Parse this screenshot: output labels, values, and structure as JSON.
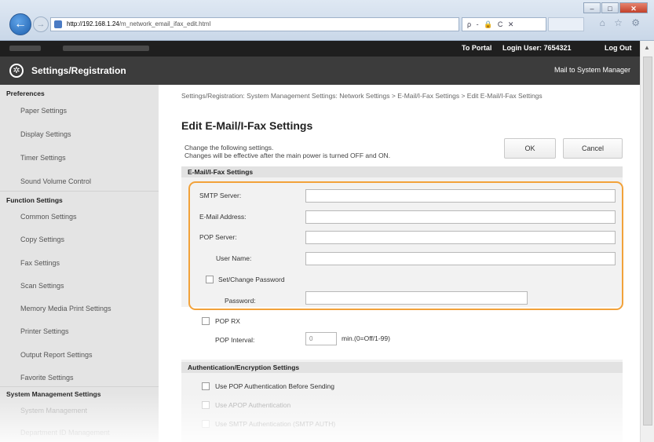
{
  "browser": {
    "url_host": "http://192.168.1.24",
    "url_path": "/m_network_email_ifax_edit.html",
    "addr_tools": "ρ - 🔒 C ✕",
    "window_buttons": {
      "minimize": "–",
      "maximize": "□",
      "close": "✕"
    },
    "right_icons": "⌂ ☆ ⚙"
  },
  "header": {
    "to_portal": "To Portal",
    "login_user": "Login User:  7654321",
    "log_out": "Log Out",
    "title": "Settings/Registration",
    "mail_link": "Mail to System Manager"
  },
  "sidebar": {
    "sections": [
      {
        "label": "Preferences",
        "items": [
          "Paper Settings",
          "Display Settings",
          "Timer Settings",
          "Sound Volume Control"
        ]
      },
      {
        "label": "Function Settings",
        "items": [
          "Common Settings",
          "Copy Settings",
          "Fax Settings",
          "Scan Settings",
          "Memory Media Print Settings",
          "Printer Settings",
          "Output Report Settings",
          "Favorite Settings"
        ]
      },
      {
        "label": "System Management Settings",
        "items": [
          "System Management",
          "Department ID Management"
        ]
      }
    ]
  },
  "main": {
    "breadcrumb": "Settings/Registration: System Management Settings: Network Settings > E-Mail/I-Fax Settings > Edit E-Mail/I-Fax Settings",
    "page_title": "Edit E-Mail/I-Fax Settings",
    "instruction_1": "Change the following settings.",
    "instruction_2": "Changes will be effective after the main power is turned OFF and ON.",
    "ok": "OK",
    "cancel": "Cancel",
    "panel_title": "E-Mail/I-Fax Settings",
    "fields": {
      "smtp_server": {
        "label": "SMTP Server:",
        "value": ""
      },
      "email_address": {
        "label": "E-Mail Address:",
        "value": ""
      },
      "pop_server": {
        "label": "POP Server:",
        "value": ""
      },
      "user_name": {
        "label": "User Name:",
        "value": ""
      },
      "set_change_password": {
        "label": "Set/Change Password",
        "checked": false
      },
      "password": {
        "label": "Password:",
        "value": ""
      },
      "pop_rx": {
        "label": "POP RX",
        "checked": false
      },
      "pop_interval": {
        "label": "POP Interval:",
        "value": "0",
        "unit": "min.(0=Off/1-99)"
      }
    },
    "auth_title": "Authentication/Encryption Settings",
    "auth_options": [
      {
        "label": "Use POP Authentication Before Sending",
        "checked": false
      },
      {
        "label": "Use APOP Authentication",
        "checked": false
      },
      {
        "label": "Use SMTP Authentication (SMTP AUTH)",
        "checked": false
      }
    ]
  },
  "colors": {
    "highlight": "#f2a23a",
    "header_dark": "#1f1f1f",
    "title_bar": "#3c3c3c",
    "sidebar_bg": "#e4e4e4"
  }
}
